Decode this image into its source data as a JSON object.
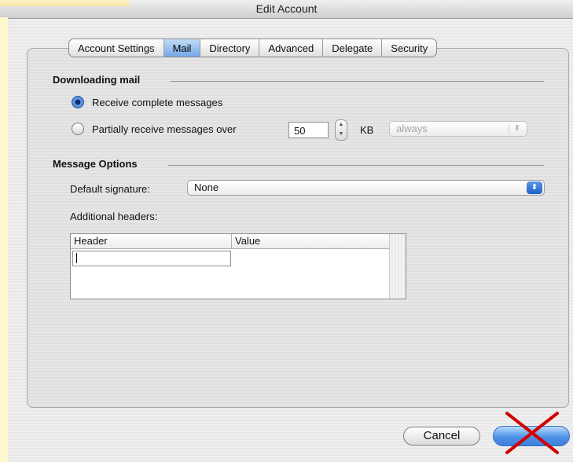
{
  "window": {
    "title": "Edit Account"
  },
  "tabs": [
    {
      "label": "Account Settings",
      "active": false
    },
    {
      "label": "Mail",
      "active": true
    },
    {
      "label": "Directory",
      "active": false
    },
    {
      "label": "Advanced",
      "active": false
    },
    {
      "label": "Delegate",
      "active": false
    },
    {
      "label": "Security",
      "active": false
    }
  ],
  "downloading": {
    "title": "Downloading mail",
    "option_complete": "Receive complete messages",
    "option_partial": "Partially receive messages over",
    "selected": "complete",
    "size_value": "50",
    "size_unit": "KB",
    "frequency_value": "always"
  },
  "message_options": {
    "title": "Message Options",
    "signature_label": "Default signature:",
    "signature_value": "None",
    "headers_label": "Additional headers:",
    "columns": [
      "Header",
      "Value"
    ],
    "rows": []
  },
  "buttons": {
    "cancel": "Cancel"
  },
  "colors": {
    "accent": "#2f74d0",
    "overlay_x": "#d10000"
  }
}
